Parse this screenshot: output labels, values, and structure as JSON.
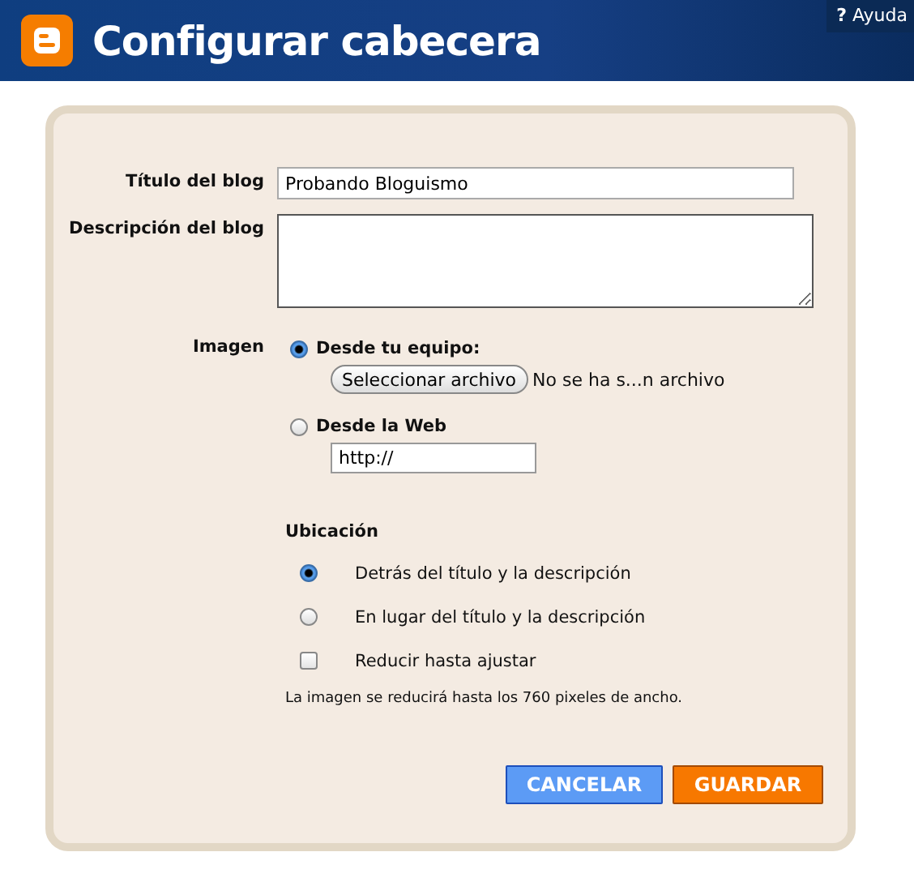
{
  "header": {
    "title": "Configurar cabecera",
    "help": {
      "icon": "?",
      "label": "Ayuda"
    }
  },
  "fields": [
    {
      "label": "Título del blog",
      "kind": "input",
      "value": "Probando Bloguismo"
    },
    {
      "label": "Descripción del blog",
      "kind": "textarea"
    }
  ],
  "image": {
    "label": "Imagen",
    "sources": [
      {
        "label": "Desde tu equipo:",
        "selected": true,
        "kind": "file",
        "button": "Seleccionar archivo",
        "status": "No se ha s...n archivo"
      },
      {
        "label": "Desde la Web",
        "selected": false,
        "kind": "url",
        "value": "http://"
      }
    ]
  },
  "location": {
    "title": "Ubicación",
    "options": [
      {
        "kind": "radio",
        "label": "Detrás del título y la descripción",
        "selected": true
      },
      {
        "kind": "radio",
        "label": "En lugar del título y la descripción",
        "selected": false
      },
      {
        "kind": "checkbox",
        "label": "Reducir hasta ajustar",
        "checked": false
      }
    ],
    "note": "La imagen se reducirá hasta los 760 pixeles de ancho."
  },
  "buttons": [
    {
      "label": "CANCELAR",
      "kind": "secondary"
    },
    {
      "label": "GUARDAR",
      "kind": "primary"
    }
  ]
}
